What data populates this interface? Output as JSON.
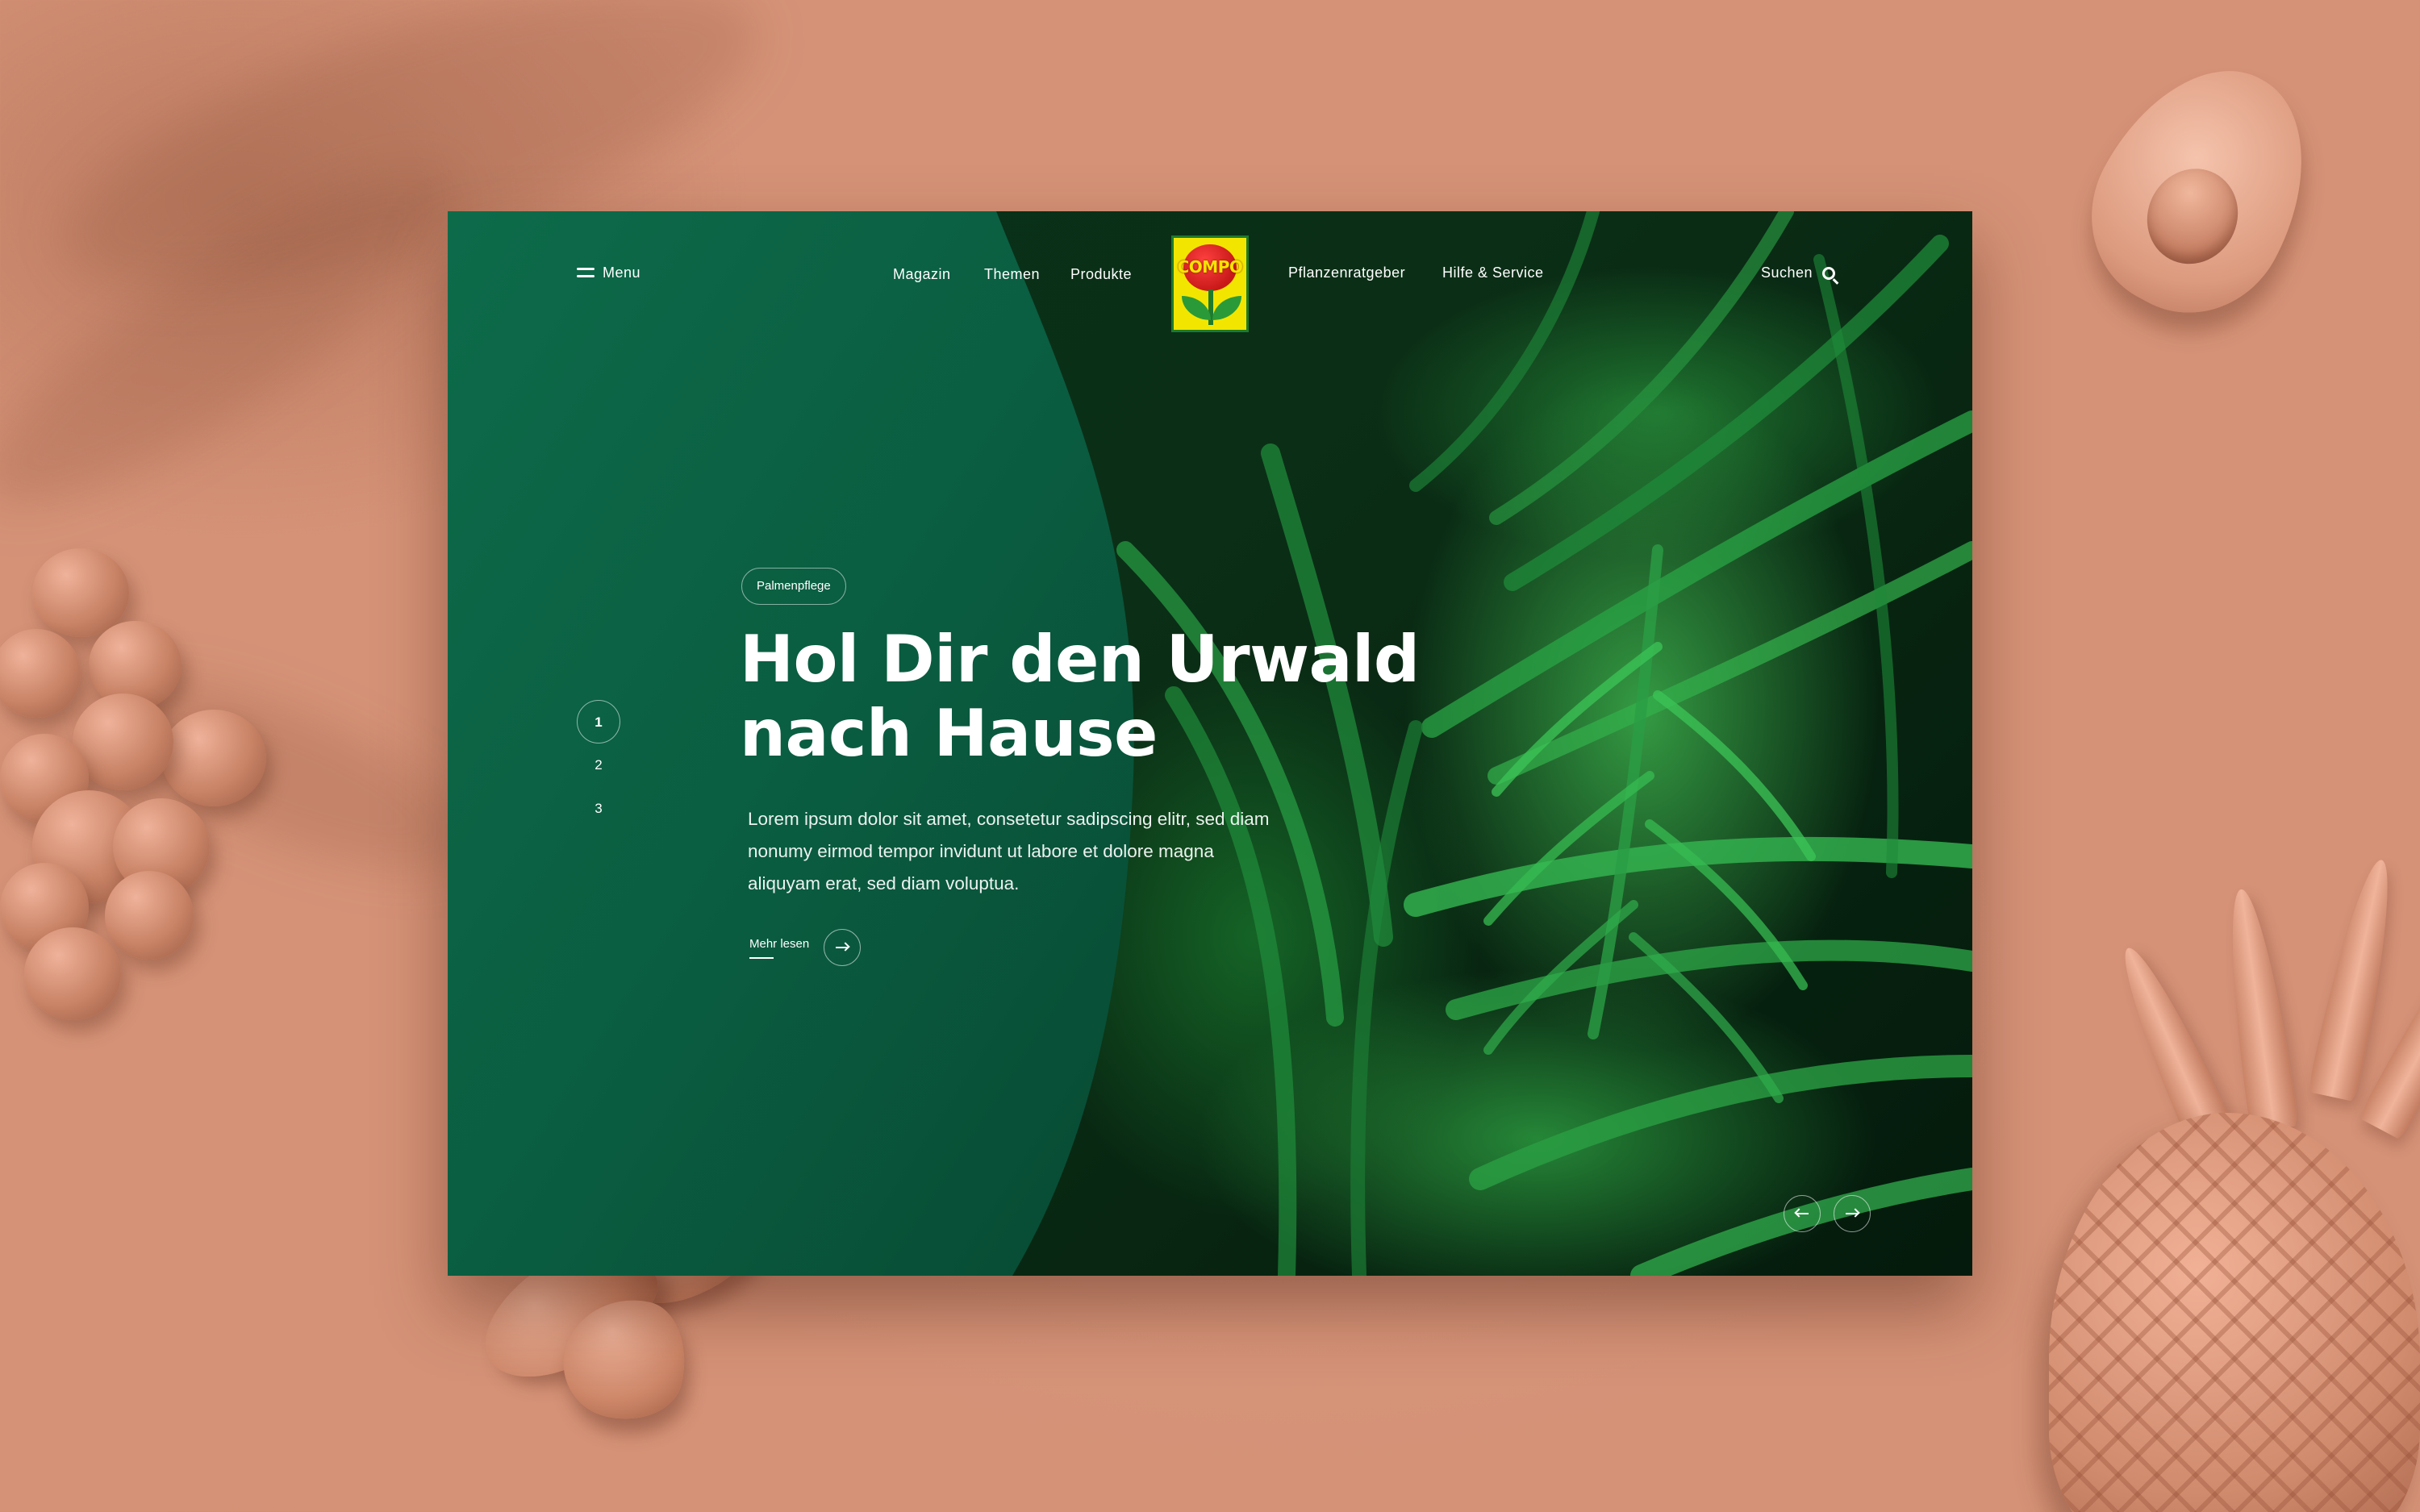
{
  "nav": {
    "menu_label": "Menu",
    "links": [
      "Magazin",
      "Themen",
      "Produkte",
      "Pflanzenratgeber",
      "Hilfe & Service"
    ],
    "search_label": "Suchen"
  },
  "logo": {
    "text": "COMPO"
  },
  "pager": {
    "items": [
      "1",
      "2",
      "3"
    ],
    "active": "1"
  },
  "hero": {
    "tag": "Palmenpflege",
    "headline_line1": "Hol Dir den Urwald",
    "headline_line2": "nach Hause",
    "body": "Lorem ipsum dolor sit amet, consetetur sadipscing elitr, sed diam nonumy eirmod tempor invidunt ut labore et dolore magna aliquyam erat, sed diam voluptua.",
    "read_more": "Mehr lesen"
  },
  "icons": {
    "menu": "menu-icon",
    "search": "search-icon",
    "arrow_right": "arrow-right-icon",
    "arrow_left": "arrow-left-icon"
  },
  "colors": {
    "panel_green": "#0a6144",
    "background": "#d59277",
    "logo_yellow": "#f2e600",
    "logo_red": "#d41e1e"
  }
}
